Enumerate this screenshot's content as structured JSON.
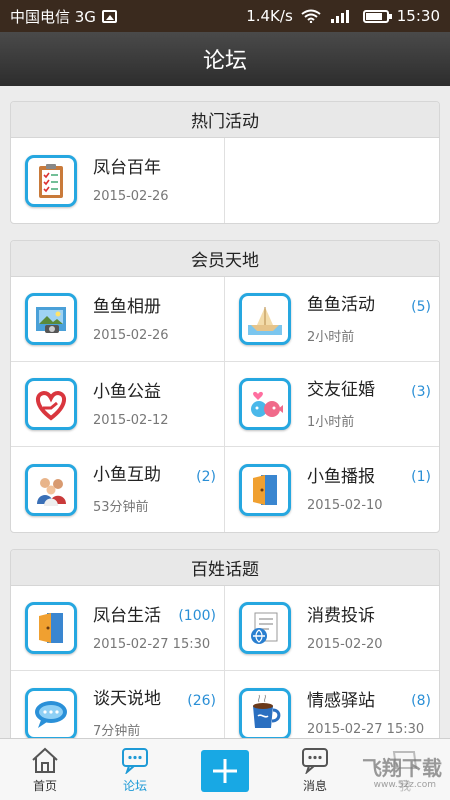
{
  "status_bar": {
    "carrier": "中国电信 3G",
    "speed": "1.4K/s",
    "time": "15:30"
  },
  "header": {
    "title": "论坛"
  },
  "sections": [
    {
      "title": "热门活动",
      "items": [
        {
          "title": "凤台百年",
          "date": "2015-02-26",
          "count": "",
          "icon": "clipboard-icon"
        }
      ]
    },
    {
      "title": "会员天地",
      "items": [
        {
          "title": "鱼鱼相册",
          "date": "2015-02-26",
          "count": "",
          "icon": "photo-album-icon"
        },
        {
          "title": "鱼鱼活动",
          "date": "2小时前",
          "count": "(5)",
          "icon": "paper-boat-icon"
        },
        {
          "title": "小鱼公益",
          "date": "2015-02-12",
          "count": "",
          "icon": "heart-hand-icon"
        },
        {
          "title": "交友征婚",
          "date": "1小时前",
          "count": "(3)",
          "icon": "kissing-fish-icon"
        },
        {
          "title": "小鱼互助",
          "date": "53分钟前",
          "count": "(2)",
          "icon": "people-group-icon"
        },
        {
          "title": "小鱼播报",
          "date": "2015-02-10",
          "count": "(1)",
          "icon": "broadcast-door-icon"
        }
      ]
    },
    {
      "title": "百姓话题",
      "items": [
        {
          "title": "凤台生活",
          "date": "2015-02-27 15:30",
          "count": "(100)",
          "icon": "life-door-icon"
        },
        {
          "title": "消费投诉",
          "date": "2015-02-20",
          "count": "",
          "icon": "complaint-document-icon"
        },
        {
          "title": "谈天说地",
          "date": "7分钟前",
          "count": "(26)",
          "icon": "chat-bubble-icon"
        },
        {
          "title": "情感驿站",
          "date": "2015-02-27 15:30",
          "count": "(8)",
          "icon": "coffee-mug-icon"
        }
      ]
    }
  ],
  "tabbar": {
    "items": [
      {
        "label": "首页",
        "icon": "home-icon"
      },
      {
        "label": "论坛",
        "icon": "forum-chat-icon"
      },
      {
        "label": "",
        "icon": "plus-icon"
      },
      {
        "label": "消息",
        "icon": "message-icon"
      },
      {
        "label": "我",
        "icon": "profile-icon"
      }
    ]
  },
  "watermark": {
    "text": "飞翔下载",
    "sub": "www.52z.com"
  },
  "colors": {
    "accent": "#1e9ad6",
    "title_bar": "#2d2d2d",
    "status_bar": "#3a2a1e"
  }
}
